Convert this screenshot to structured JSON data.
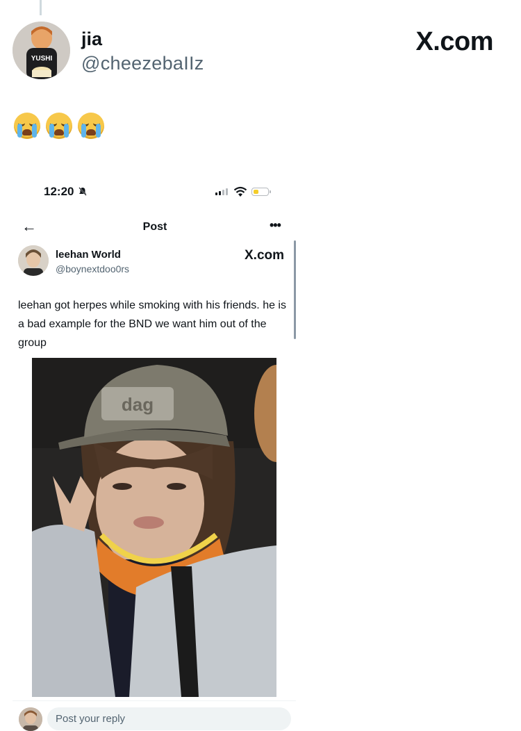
{
  "post": {
    "author_name": "jia",
    "author_handle": "@cheezebaIIz",
    "avatar_shirt_text": "YUSHI",
    "watermark": "X.com",
    "emojis": [
      "😭",
      "😭",
      "😭"
    ]
  },
  "quoted_screenshot": {
    "status_time": "12:20",
    "nav_title": "Post",
    "more_label": "•••",
    "back_label": "←",
    "author_name": "leehan World",
    "author_handle": "@boynextdoo0rs",
    "watermark": "X.com",
    "text": "leehan got herpes while smoking with his friends. he is a bad example for the BND we want him out of the group",
    "photo_cap_logo": "dag",
    "reply_placeholder": "Post your reply",
    "battery_level": 0.3
  },
  "colors": {
    "text": "#0f1419",
    "secondary": "#536471",
    "emoji_face": "#f7c84a",
    "battery": "#f4cd2a"
  }
}
